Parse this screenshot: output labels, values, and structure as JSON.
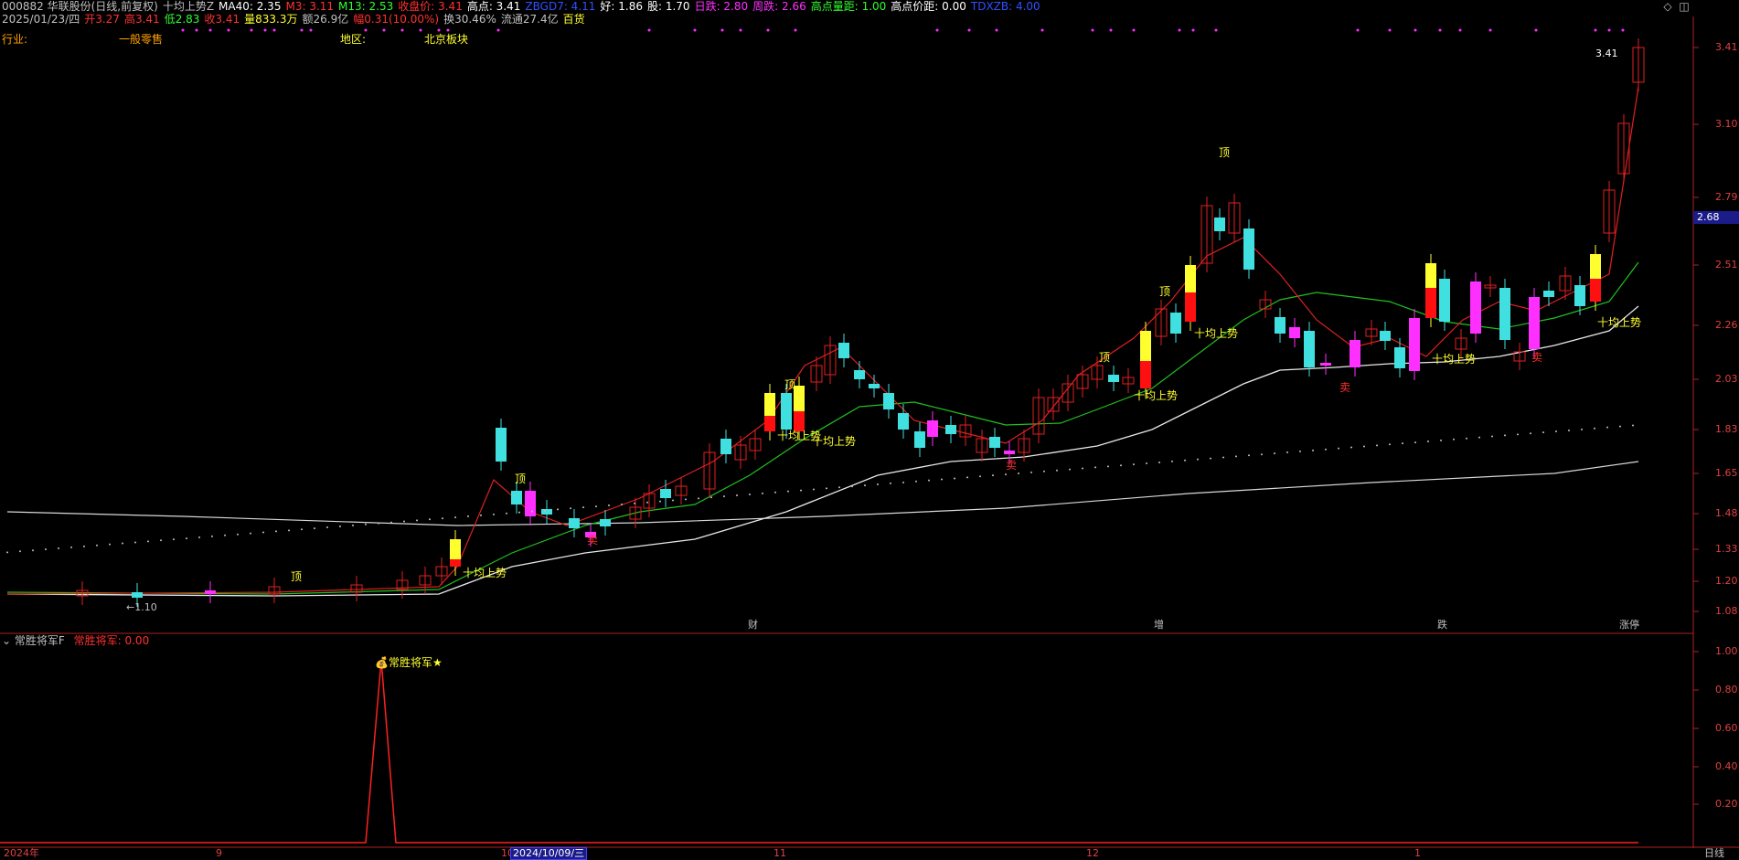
{
  "header": {
    "line1": [
      {
        "text": "000882 华联股份(日线,前复权)",
        "color": "#c0c0c0"
      },
      {
        "text": "十均上势Z",
        "color": "#c0c0c0"
      },
      {
        "text": "MA40: 2.35",
        "color": "#ffffff"
      },
      {
        "text": "M3: 3.11",
        "color": "#ff3030"
      },
      {
        "text": "M13: 2.53",
        "color": "#30ff30"
      },
      {
        "text": "收盘价: 3.41",
        "color": "#ff3030"
      },
      {
        "text": "高点: 3.41",
        "color": "#ffffff"
      },
      {
        "text": "ZBGD7: 4.11",
        "color": "#3050ff"
      },
      {
        "text": "好: 1.86",
        "color": "#ffffff"
      },
      {
        "text": "股: 1.70",
        "color": "#ffffff"
      },
      {
        "text": "日跌: 2.80",
        "color": "#ff30ff"
      },
      {
        "text": "周跌: 2.66",
        "color": "#ff30ff"
      },
      {
        "text": "高点量距: 1.00",
        "color": "#30ff30"
      },
      {
        "text": "高点价距: 0.00",
        "color": "#ffffff"
      },
      {
        "text": "TDXZB: 4.00",
        "color": "#3050ff"
      }
    ],
    "line2": [
      {
        "text": "2025/01/23/四",
        "color": "#c0c0c0"
      },
      {
        "text": "开3.27",
        "color": "#ff3030"
      },
      {
        "text": "高3.41",
        "color": "#ff3030"
      },
      {
        "text": "低2.83",
        "color": "#30ff30"
      },
      {
        "text": "收3.41",
        "color": "#ff3030"
      },
      {
        "text": "量833.3万",
        "color": "#ffff30"
      },
      {
        "text": "额26.9亿",
        "color": "#c0c0c0"
      },
      {
        "text": "幅0.31(10.00%)",
        "color": "#ff3030"
      },
      {
        "text": "换30.46%",
        "color": "#c0c0c0"
      },
      {
        "text": "流通27.4亿",
        "color": "#c0c0c0"
      },
      {
        "text": "百货",
        "color": "#ffff30"
      }
    ],
    "industry_label": "行业:",
    "industry_value": "一般零售",
    "region_label": "地区:",
    "region_value": "北京板块"
  },
  "window_buttons": {
    "diamond": "◇",
    "restore": "◫"
  },
  "price_axis": {
    "labels": [
      "3.41",
      "3.10",
      "2.79",
      "2.51",
      "2.26",
      "2.03",
      "1.83",
      "1.65",
      "1.48",
      "1.33",
      "1.20",
      "1.08"
    ],
    "current": "2.68"
  },
  "indicator_axis": {
    "labels": [
      "1.00",
      "0.80",
      "0.60",
      "0.40",
      "0.20"
    ]
  },
  "indicator": {
    "title": "常胜将军F",
    "value": "常胜将军: 0.00",
    "signal_label": "常胜将军★"
  },
  "chart_annotations": {
    "high_label": "3.41",
    "low_label": "1.10",
    "top_marker": "顶",
    "sell_marker": "卖",
    "uptrend_label": "十均上势"
  },
  "events": [
    {
      "text": "财",
      "color": "#6080ff"
    },
    {
      "text": "增",
      "color": "#c0c0c0"
    },
    {
      "text": "跌",
      "color": "#30ff30"
    },
    {
      "text": "涨停",
      "color": "#ffffff"
    }
  ],
  "x_axis": {
    "labels": [
      "2024年",
      "9",
      "10",
      "11",
      "12",
      "1"
    ],
    "selected_date": "2024/10/09/三",
    "period": "日线"
  },
  "chart_data": {
    "type": "candlestick",
    "ma_lines": [
      "M3",
      "M13",
      "MA40",
      "MA"
    ],
    "ylim": [
      1.08,
      3.41
    ],
    "last": {
      "open": 3.27,
      "high": 3.41,
      "low": 2.83,
      "close": 3.41
    }
  }
}
